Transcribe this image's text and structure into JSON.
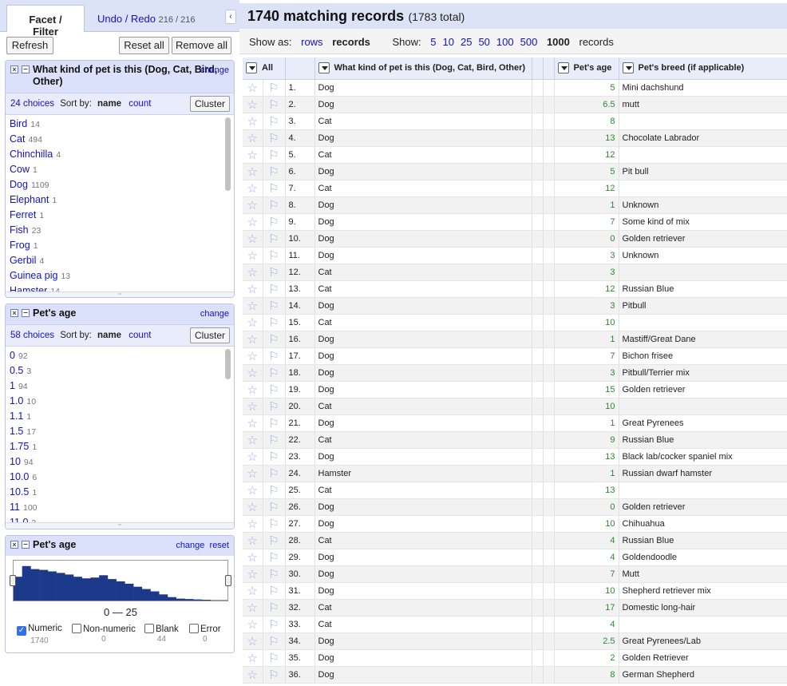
{
  "left_tabs": {
    "facet": "Facet / Filter",
    "undo": "Undo / Redo",
    "undo_count": "216 / 216",
    "collapse": "‹"
  },
  "buttons": {
    "refresh": "Refresh",
    "reset_all": "Reset all",
    "remove_all": "Remove all"
  },
  "facet_pet": {
    "title": "What kind of pet is this (Dog, Cat, Bird, Other)",
    "change": "change",
    "choices_count": "24 choices",
    "sort_by": "Sort by:",
    "sort_name": "name",
    "sort_count": "count",
    "cluster": "Cluster",
    "items": [
      {
        "label": "Bird",
        "count": "14"
      },
      {
        "label": "Cat",
        "count": "494"
      },
      {
        "label": "Chinchilla",
        "count": "4"
      },
      {
        "label": "Cow",
        "count": "1"
      },
      {
        "label": "Dog",
        "count": "1109"
      },
      {
        "label": "Elephant",
        "count": "1"
      },
      {
        "label": "Ferret",
        "count": "1"
      },
      {
        "label": "Fish",
        "count": "23"
      },
      {
        "label": "Frog",
        "count": "1"
      },
      {
        "label": "Gerbil",
        "count": "4"
      },
      {
        "label": "Guinea pig",
        "count": "13"
      },
      {
        "label": "Hamster",
        "count": "14"
      }
    ]
  },
  "facet_age": {
    "title": "Pet's age",
    "change": "change",
    "choices_count": "58 choices",
    "sort_by": "Sort by:",
    "sort_name": "name",
    "sort_count": "count",
    "cluster": "Cluster",
    "items": [
      {
        "label": "0",
        "count": "92"
      },
      {
        "label": "0.5",
        "count": "3"
      },
      {
        "label": "1",
        "count": "94"
      },
      {
        "label": "1.0",
        "count": "10"
      },
      {
        "label": "1.1",
        "count": "1"
      },
      {
        "label": "1.5",
        "count": "17"
      },
      {
        "label": "1.75",
        "count": "1"
      },
      {
        "label": "10",
        "count": "94"
      },
      {
        "label": "10.0",
        "count": "6"
      },
      {
        "label": "10.5",
        "count": "1"
      },
      {
        "label": "11",
        "count": "100"
      },
      {
        "label": "11.0",
        "count": "3"
      }
    ]
  },
  "facet_hist": {
    "title": "Pet's age",
    "change": "change",
    "reset": "reset",
    "range": "0 — 25",
    "bar_color": "#1d3a8a",
    "histogram": [
      0.62,
      0.9,
      0.82,
      0.8,
      0.76,
      0.72,
      0.68,
      0.62,
      0.58,
      0.6,
      0.66,
      0.56,
      0.5,
      0.44,
      0.36,
      0.3,
      0.24,
      0.16,
      0.09,
      0.05,
      0.04,
      0.03,
      0.02,
      0.01,
      0.01
    ],
    "checks": [
      {
        "label": "Numeric",
        "count": "1740",
        "checked": true
      },
      {
        "label": "Non-numeric",
        "count": "0",
        "checked": false
      },
      {
        "label": "Blank",
        "count": "44",
        "checked": false
      },
      {
        "label": "Error",
        "count": "0",
        "checked": false
      }
    ]
  },
  "summary": {
    "matching": "1740 matching records",
    "total": "(1783 total)"
  },
  "viewbar": {
    "show_as": "Show as:",
    "rows": "rows",
    "records": "records",
    "show": "Show:",
    "opts": [
      "5",
      "10",
      "25",
      "50",
      "100",
      "500"
    ],
    "selected": "1000",
    "suffix": "records"
  },
  "columns": {
    "all": "All",
    "pet": "What kind of pet is this (Dog, Cat, Bird, Other)",
    "age": "Pet's age",
    "breed": "Pet's breed (if applicable)"
  },
  "rows": [
    {
      "n": "1.",
      "pet": "Dog",
      "age": "5",
      "breed": "Mini dachshund"
    },
    {
      "n": "2.",
      "pet": "Dog",
      "age": "6.5",
      "breed": "mutt"
    },
    {
      "n": "3.",
      "pet": "Cat",
      "age": "8",
      "breed": ""
    },
    {
      "n": "4.",
      "pet": "Dog",
      "age": "13",
      "breed": "Chocolate Labrador"
    },
    {
      "n": "5.",
      "pet": "Cat",
      "age": "12",
      "breed": ""
    },
    {
      "n": "6.",
      "pet": "Dog",
      "age": "5",
      "breed": "Pit bull"
    },
    {
      "n": "7.",
      "pet": "Cat",
      "age": "12",
      "breed": ""
    },
    {
      "n": "8.",
      "pet": "Dog",
      "age": "1",
      "breed": "Unknown"
    },
    {
      "n": "9.",
      "pet": "Dog",
      "age": "7",
      "breed": "Some kind of mix"
    },
    {
      "n": "10.",
      "pet": "Dog",
      "age": "0",
      "breed": "Golden retriever"
    },
    {
      "n": "11.",
      "pet": "Dog",
      "age": "3",
      "breed": "Unknown"
    },
    {
      "n": "12.",
      "pet": "Cat",
      "age": "3",
      "breed": ""
    },
    {
      "n": "13.",
      "pet": "Cat",
      "age": "12",
      "breed": "Russian Blue"
    },
    {
      "n": "14.",
      "pet": "Dog",
      "age": "3",
      "breed": "Pitbull"
    },
    {
      "n": "15.",
      "pet": "Cat",
      "age": "10",
      "breed": ""
    },
    {
      "n": "16.",
      "pet": "Dog",
      "age": "1",
      "breed": "Mastiff/Great Dane"
    },
    {
      "n": "17.",
      "pet": "Dog",
      "age": "7",
      "breed": "Bichon frisee"
    },
    {
      "n": "18.",
      "pet": "Dog",
      "age": "3",
      "breed": "Pitbull/Terrier mix"
    },
    {
      "n": "19.",
      "pet": "Dog",
      "age": "15",
      "breed": "Golden retriever"
    },
    {
      "n": "20.",
      "pet": "Cat",
      "age": "10",
      "breed": ""
    },
    {
      "n": "21.",
      "pet": "Dog",
      "age": "1",
      "breed": "Great Pyrenees"
    },
    {
      "n": "22.",
      "pet": "Cat",
      "age": "9",
      "breed": "Russian Blue"
    },
    {
      "n": "23.",
      "pet": "Dog",
      "age": "13",
      "breed": "Black lab/cocker spaniel mix"
    },
    {
      "n": "24.",
      "pet": "Hamster",
      "age": "1",
      "breed": "Russian dwarf hamster"
    },
    {
      "n": "25.",
      "pet": "Cat",
      "age": "13",
      "breed": ""
    },
    {
      "n": "26.",
      "pet": "Dog",
      "age": "0",
      "breed": "Golden retriever"
    },
    {
      "n": "27.",
      "pet": "Dog",
      "age": "10",
      "breed": "Chihuahua"
    },
    {
      "n": "28.",
      "pet": "Cat",
      "age": "4",
      "breed": "Russian Blue"
    },
    {
      "n": "29.",
      "pet": "Dog",
      "age": "4",
      "breed": "Goldendoodle"
    },
    {
      "n": "30.",
      "pet": "Dog",
      "age": "7",
      "breed": "Mutt"
    },
    {
      "n": "31.",
      "pet": "Dog",
      "age": "10",
      "breed": "Shepherd retriever mix"
    },
    {
      "n": "32.",
      "pet": "Cat",
      "age": "17",
      "breed": "Domestic long-hair"
    },
    {
      "n": "33.",
      "pet": "Cat",
      "age": "4",
      "breed": ""
    },
    {
      "n": "34.",
      "pet": "Dog",
      "age": "2.5",
      "breed": "Great Pyrenees/Lab"
    },
    {
      "n": "35.",
      "pet": "Dog",
      "age": "2",
      "breed": "Golden Retriever"
    },
    {
      "n": "36.",
      "pet": "Dog",
      "age": "8",
      "breed": "German Shepherd"
    }
  ]
}
